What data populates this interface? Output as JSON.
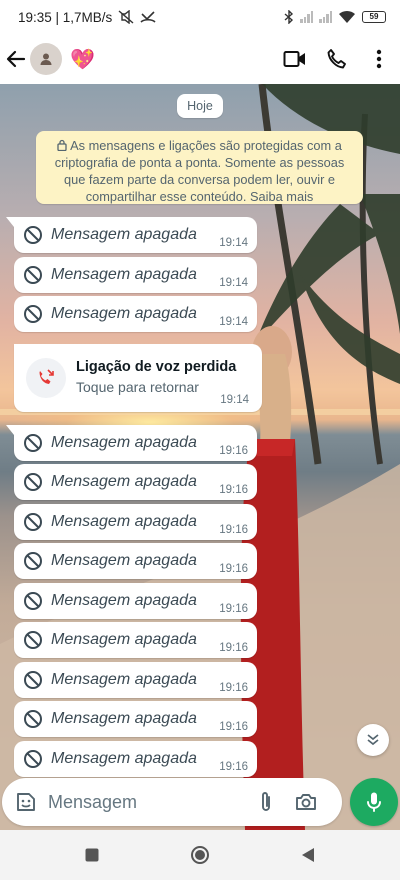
{
  "status_bar": {
    "left_text": "19:35 | 1,7MB/s",
    "battery": "59"
  },
  "header": {
    "contact_emoji": "💖"
  },
  "chat": {
    "date_chip": "Hoje",
    "encryption_notice": "As mensagens e ligações são protegidas com a criptografia de ponta a ponta. Somente as pessoas que fazem parte da conversa podem ler, ouvir e compartilhar esse conteúdo. Saiba mais",
    "messages": [
      {
        "text": "Mensagem apagada",
        "time": "19:14"
      },
      {
        "text": "Mensagem apagada",
        "time": "19:14"
      },
      {
        "text": "Mensagem apagada",
        "time": "19:14"
      },
      {
        "text": "Mensagem apagada",
        "time": "19:16"
      },
      {
        "text": "Mensagem apagada",
        "time": "19:16"
      },
      {
        "text": "Mensagem apagada",
        "time": "19:16"
      },
      {
        "text": "Mensagem apagada",
        "time": "19:16"
      },
      {
        "text": "Mensagem apagada",
        "time": "19:16"
      },
      {
        "text": "Mensagem apagada",
        "time": "19:16"
      },
      {
        "text": "Mensagem apagada",
        "time": "19:16"
      },
      {
        "text": "Mensagem apagada",
        "time": "19:16"
      },
      {
        "text": "Mensagem apagada",
        "time": "19:16"
      }
    ],
    "missed_call": {
      "title": "Ligação de voz perdida",
      "subtitle": "Toque para retornar",
      "time": "19:14"
    }
  },
  "composer": {
    "placeholder": "Mensagem"
  },
  "colors": {
    "accent_green": "#1daa61",
    "missed_call_red": "#e53935",
    "notice_bg": "#fdf3c5"
  },
  "icons": [
    "back-arrow-icon",
    "avatar-icon",
    "video-call-icon",
    "phone-icon",
    "more-icon",
    "lock-icon",
    "deleted-icon",
    "missed-call-icon",
    "chevron-down-icon",
    "sticker-icon",
    "attach-icon",
    "camera-icon",
    "mic-icon",
    "nav-square-icon",
    "nav-circle-icon",
    "nav-back-icon"
  ]
}
